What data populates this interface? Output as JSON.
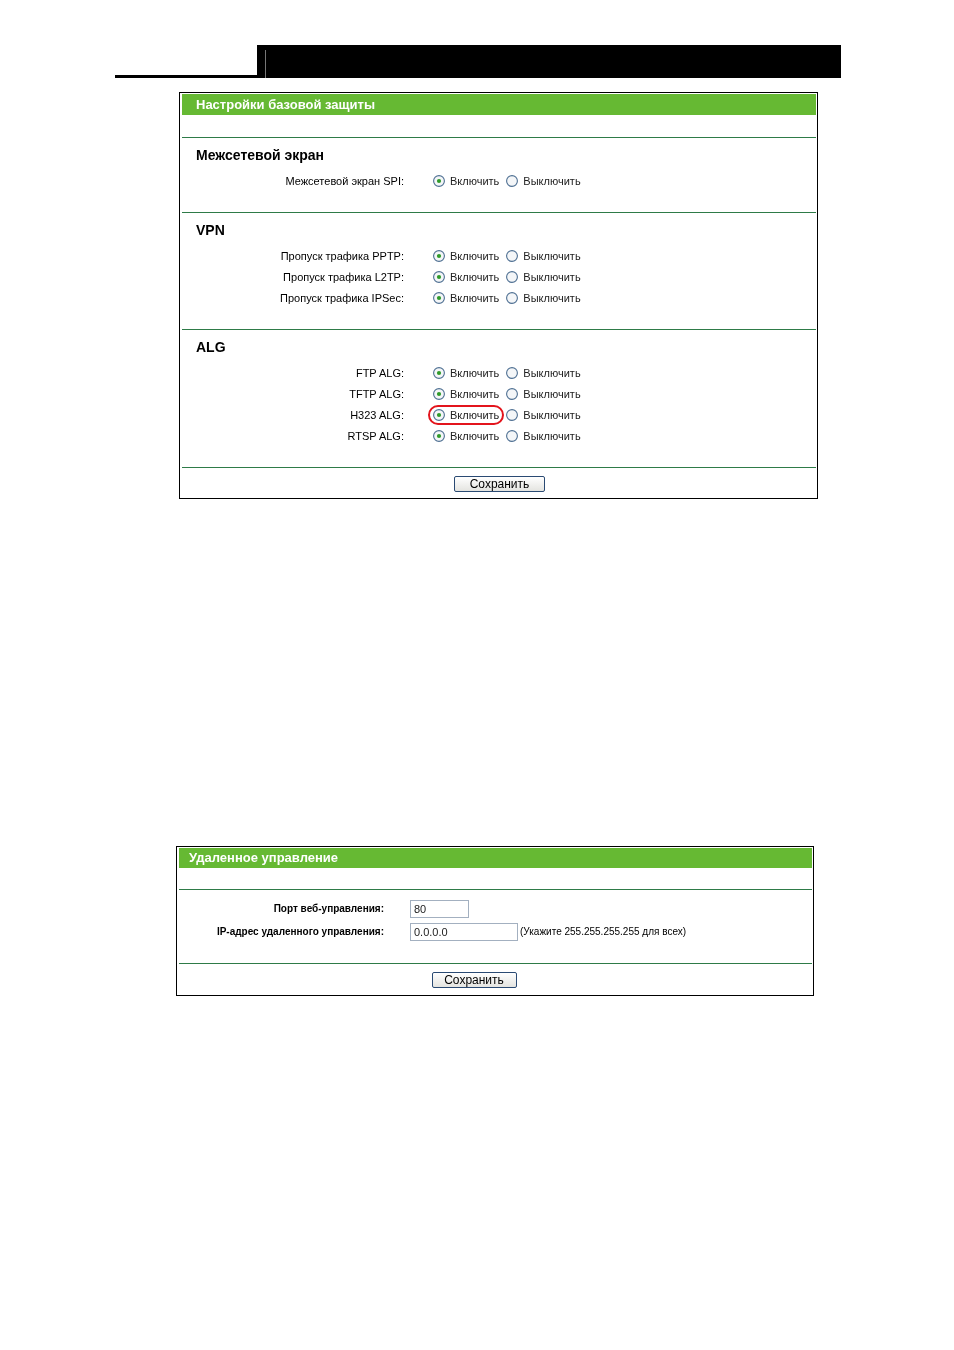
{
  "security_panel": {
    "title": "Настройки базовой защиты",
    "sections": [
      {
        "heading": "Межсетевой экран",
        "rows": [
          {
            "label": "Межсетевой экран SPI:",
            "options": [
              {
                "label": "Включить",
                "selected": true,
                "highlighted": false
              },
              {
                "label": "Выключить",
                "selected": false,
                "highlighted": false
              }
            ]
          }
        ]
      },
      {
        "heading": "VPN",
        "rows": [
          {
            "label": "Пропуск трафика PPTP:",
            "options": [
              {
                "label": "Включить",
                "selected": true,
                "highlighted": false
              },
              {
                "label": "Выключить",
                "selected": false,
                "highlighted": false
              }
            ]
          },
          {
            "label": "Пропуск трафика L2TP:",
            "options": [
              {
                "label": "Включить",
                "selected": true,
                "highlighted": false
              },
              {
                "label": "Выключить",
                "selected": false,
                "highlighted": false
              }
            ]
          },
          {
            "label": "Пропуск трафика IPSec:",
            "options": [
              {
                "label": "Включить",
                "selected": true,
                "highlighted": false
              },
              {
                "label": "Выключить",
                "selected": false,
                "highlighted": false
              }
            ]
          }
        ]
      },
      {
        "heading": "ALG",
        "rows": [
          {
            "label": "FTP ALG:",
            "options": [
              {
                "label": "Включить",
                "selected": true,
                "highlighted": false
              },
              {
                "label": "Выключить",
                "selected": false,
                "highlighted": false
              }
            ]
          },
          {
            "label": "TFTP ALG:",
            "options": [
              {
                "label": "Включить",
                "selected": true,
                "highlighted": false
              },
              {
                "label": "Выключить",
                "selected": false,
                "highlighted": false
              }
            ]
          },
          {
            "label": "H323 ALG:",
            "options": [
              {
                "label": "Включить",
                "selected": true,
                "highlighted": true
              },
              {
                "label": "Выключить",
                "selected": false,
                "highlighted": false
              }
            ]
          },
          {
            "label": "RTSP ALG:",
            "options": [
              {
                "label": "Включить",
                "selected": true,
                "highlighted": false
              },
              {
                "label": "Выключить",
                "selected": false,
                "highlighted": false
              }
            ]
          }
        ]
      }
    ],
    "save_button": "Сохранить"
  },
  "remote_panel": {
    "title": "Удаленное управление",
    "fields": [
      {
        "kind": "short",
        "label": "Порт веб-управления:",
        "value": "80"
      },
      {
        "kind": "long",
        "label": "IP-адрес удаленного управления:",
        "value": "0.0.0.0",
        "hint": "(Укажите 255.255.255.255 для всех)"
      }
    ],
    "save_button": "Сохранить"
  }
}
